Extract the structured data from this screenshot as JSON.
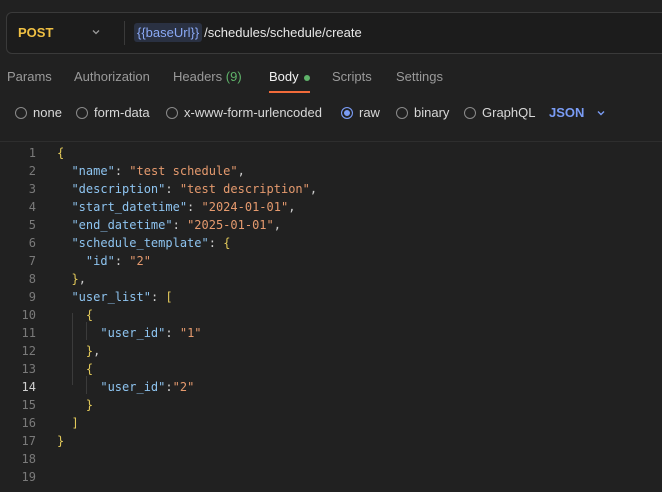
{
  "request": {
    "method": "POST",
    "url_variable": "{{baseUrl}}",
    "url_path": "/schedules/schedule/create"
  },
  "tabs": [
    {
      "label": "Params"
    },
    {
      "label": "Authorization"
    },
    {
      "label": "Headers",
      "count": "(9)"
    },
    {
      "label": "Body"
    },
    {
      "label": "Scripts"
    },
    {
      "label": "Settings"
    }
  ],
  "body_types": [
    {
      "label": "none",
      "selected": false
    },
    {
      "label": "form-data",
      "selected": false
    },
    {
      "label": "x-www-form-urlencoded",
      "selected": false
    },
    {
      "label": "raw",
      "selected": true
    },
    {
      "label": "binary",
      "selected": false
    },
    {
      "label": "GraphQL",
      "selected": false
    }
  ],
  "language": "JSON",
  "editor": {
    "current_line": 14,
    "line_numbers": [
      "1",
      "2",
      "3",
      "4",
      "5",
      "6",
      "7",
      "8",
      "9",
      "10",
      "11",
      "12",
      "13",
      "14",
      "15",
      "16",
      "17",
      "18",
      "19"
    ],
    "lines": [
      "{",
      "  \"name\": \"test schedule\",",
      "  \"description\": \"test description\",",
      "  \"start_datetime\": \"2024-01-01\",",
      "  \"end_datetime\": \"2025-01-01\",",
      "  \"schedule_template\": {",
      "    \"id\": \"2\"",
      "  },",
      "  \"user_list\": [",
      "    {",
      "      \"user_id\": \"1\"",
      "    },",
      "    {",
      "      \"user_id\":\"2\"",
      "    }",
      "  ]",
      "}",
      "",
      ""
    ]
  },
  "colors": {
    "accent_tab": "#f26b3a",
    "method": "#f0c043",
    "variable": "#8aa9f5",
    "json_key": "#8ec4f0",
    "json_string": "#e59a6e"
  }
}
